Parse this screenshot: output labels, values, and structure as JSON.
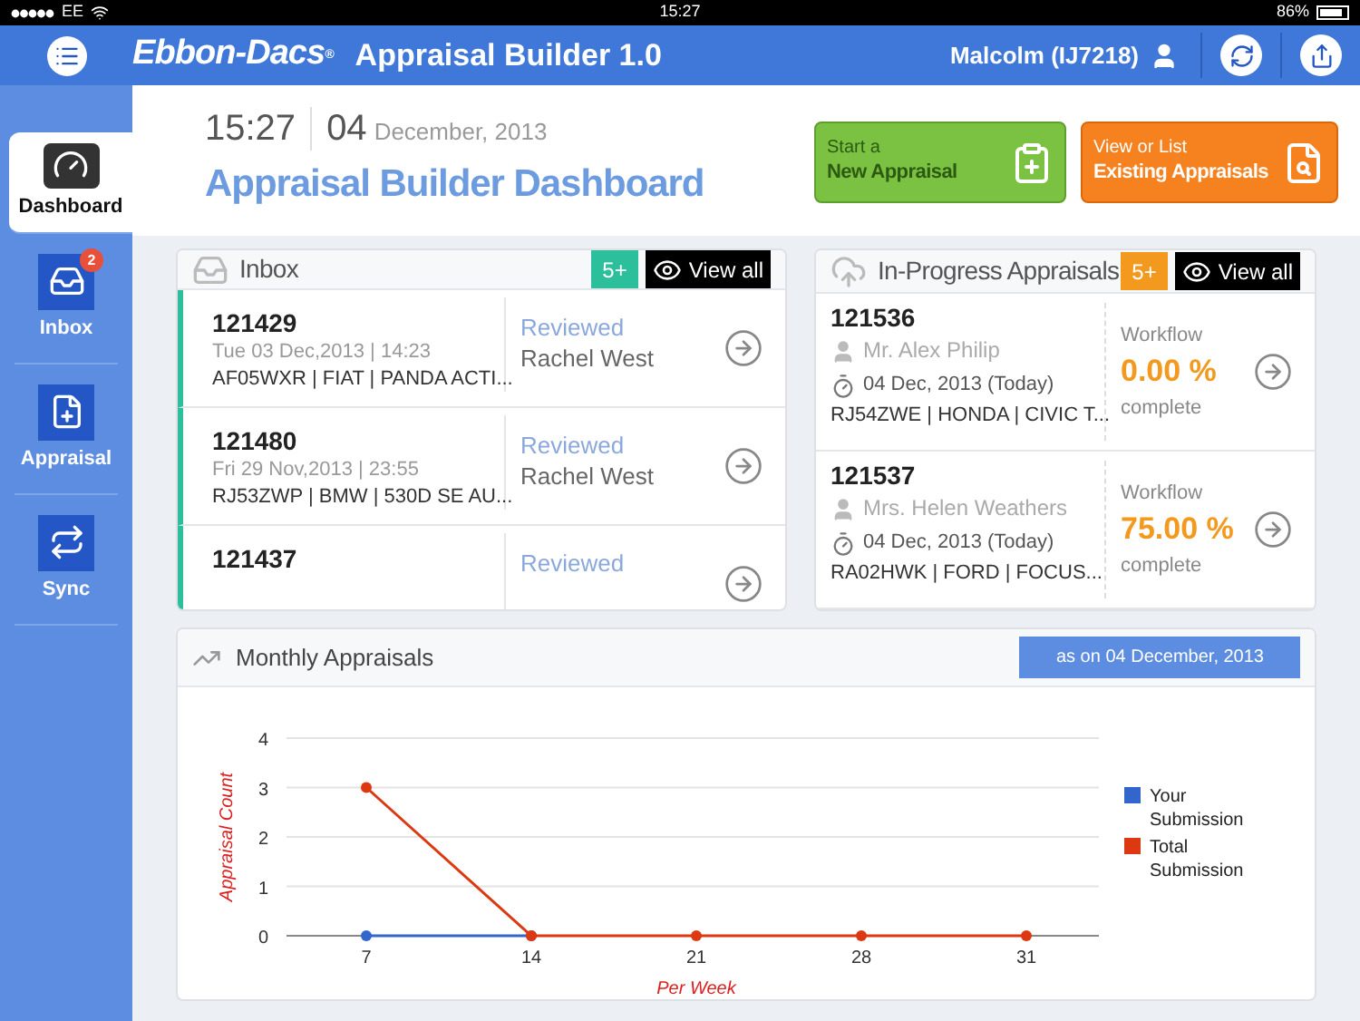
{
  "status_bar": {
    "carrier": "EE",
    "time": "15:27",
    "battery": "86%"
  },
  "header": {
    "brand": "Ebbon-Dacs",
    "brand_mark": "®",
    "app_title": "Appraisal Builder 1.0",
    "user": "Malcolm (IJ7218)"
  },
  "sidebar": {
    "items": [
      {
        "kind": "dashboard",
        "label": "Dashboard",
        "selected": true
      },
      {
        "kind": "inbox",
        "label": "Inbox",
        "selected": false,
        "badge": "2"
      },
      {
        "kind": "appraisal",
        "label": "Appraisal",
        "selected": false
      },
      {
        "kind": "sync",
        "label": "Sync",
        "selected": false
      }
    ]
  },
  "page": {
    "time": "15:27",
    "day": "04",
    "month_year": "December, 2013",
    "title": "Appraisal Builder Dashboard"
  },
  "actions": [
    {
      "kind": "new",
      "line1": "Start a",
      "line2": "New Appraisal"
    },
    {
      "kind": "existing",
      "line1": "View or List",
      "line2": "Existing Appraisals"
    }
  ],
  "inbox": {
    "title": "Inbox",
    "count": "5+",
    "view_all": "View all",
    "rows": [
      {
        "id": "121429",
        "date": "Tue 03 Dec,2013 | 14:23",
        "vehicle": "AF05WXR | FIAT | PANDA ACTI...",
        "status": "Reviewed",
        "reviewer": "Rachel West"
      },
      {
        "id": "121480",
        "date": "Fri 29 Nov,2013 | 23:55",
        "vehicle": "RJ53ZWP | BMW | 530D SE AU...",
        "status": "Reviewed",
        "reviewer": "Rachel West"
      },
      {
        "id": "121437",
        "status": "Reviewed"
      }
    ]
  },
  "in_progress": {
    "title": "In-Progress Appraisals",
    "count": "5+",
    "view_all": "View all",
    "rows": [
      {
        "id": "121536",
        "customer": "Mr. Alex Philip",
        "date": "04 Dec, 2013 (Today)",
        "vehicle": "RJ54ZWE | HONDA | CIVIC T...",
        "workflow_label": "Workflow",
        "percent": "0.00 %",
        "complete_label": "complete"
      },
      {
        "id": "121537",
        "customer": "Mrs. Helen Weathers",
        "date": "04 Dec, 2013 (Today)",
        "vehicle": "RA02HWK | FORD | FOCUS...",
        "workflow_label": "Workflow",
        "percent": "75.00 %",
        "complete_label": "complete"
      }
    ]
  },
  "monthly": {
    "title": "Monthly Appraisals",
    "as_on": "as on 04 December, 2013",
    "chart_data": {
      "type": "line",
      "xlabel": "Per Week",
      "ylabel": "Appraisal Count",
      "categories": [
        "7",
        "14",
        "21",
        "28",
        "31"
      ],
      "series": [
        {
          "name": "Your Submission",
          "color": "#3366cc",
          "marker": "circle",
          "values": [
            0,
            0,
            null,
            null,
            null
          ]
        },
        {
          "name": "Total Submission",
          "color": "#dc3912",
          "marker": "circle",
          "values": [
            3,
            0,
            0,
            0,
            0
          ]
        }
      ],
      "grid": true,
      "legend": true,
      "ylim": [
        0,
        4
      ],
      "yticks": [
        0,
        1,
        2,
        3,
        4
      ]
    }
  }
}
